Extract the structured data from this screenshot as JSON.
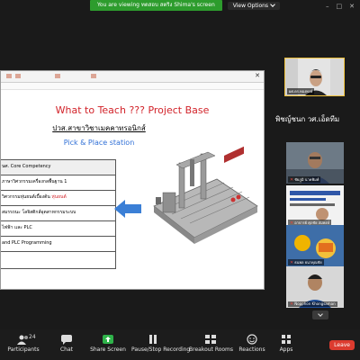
{
  "banner": {
    "share_text": "You are viewing ทดสอบ สตริง Shima's screen",
    "view_options": "View Options"
  },
  "window": {
    "minimize": "–",
    "maximize": "□",
    "close": "✕"
  },
  "slide": {
    "title": "What to Teach ??? Project Base",
    "subtitle_th": "ปวส.สาขาวิชาเมคคาทรอนิกส์",
    "subtitle_en": "Pick & Place station",
    "table_rows": [
      "นศ. Core Competency",
      "ภาษาวิศวกรรมเครื่องกลพื้นฐาน 1",
      "วิศวกรรมหุ่นยนต์เบื้องต้น",
      "สมรรถนะ โลจิสติกส์อุตสาหกรรมระบบ",
      "ไฟฟ้า และ PLC",
      "and PLC Programming",
      ""
    ],
    "table_highlight": "หุ่นยนต์"
  },
  "speaker": {
    "name": "ผศ.ดร.ทองพงษ์"
  },
  "gallery": {
    "header": "พิชญ์ชนก วศ.เอ็ดทีม",
    "participants": [
      {
        "label": "ชัยภูมิ นาคพิมพ์"
      },
      {
        "label": "อาจารย์ ศุภชัย สมพงษ์"
      },
      {
        "label": "ปวีณา วงศ์ษา"
      },
      {
        "label": "ธนพล ธนาคุณชัย"
      },
      {
        "label": "Nopphon Khongsaman"
      }
    ]
  },
  "toolbar": {
    "participants_count": "24",
    "buttons": [
      {
        "label": "Participants",
        "icon": "participants-icon"
      },
      {
        "label": "Chat",
        "icon": "chat-icon"
      },
      {
        "label": "Share Screen",
        "icon": "share-screen-icon"
      },
      {
        "label": "Pause/Stop Recording",
        "icon": "pause-icon"
      },
      {
        "label": "Breakout Rooms",
        "icon": "breakout-icon"
      },
      {
        "label": "Reactions",
        "icon": "reactions-icon"
      },
      {
        "label": "Apps",
        "icon": "apps-icon"
      }
    ],
    "leave": "Leave"
  },
  "colors": {
    "banner_green": "#2d9c2d",
    "title_red": "#d2232a",
    "subtitle_blue": "#2f6fd6",
    "arrow_blue": "#3b7fd6",
    "leave_red": "#dc3b2f",
    "speaker_border": "#f0c23c"
  }
}
